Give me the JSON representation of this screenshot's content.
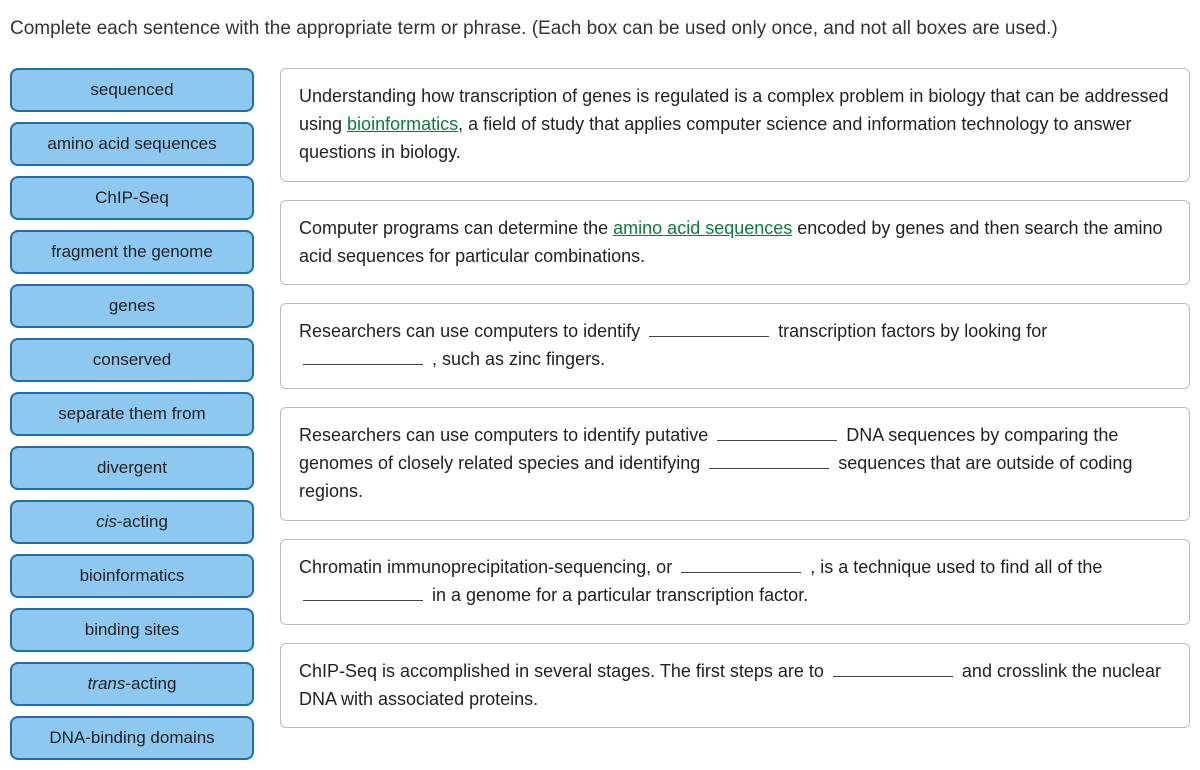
{
  "instructions": "Complete each sentence with the appropriate term or phrase. (Each box can be used only once, and not all boxes are used.)",
  "terms": [
    "sequenced",
    "amino acid sequences",
    "ChIP-Seq",
    "fragment the genome",
    "genes",
    "conserved",
    "separate them from",
    "divergent",
    "cis-acting",
    "bioinformatics",
    "binding sites",
    "trans-acting",
    "DNA-binding domains"
  ],
  "s1": {
    "p1": "Understanding how transcription of genes is regulated is a complex problem in biology that can be addressed using ",
    "ans": "bioinformatics",
    "p2": ", a field of study that applies computer science and information technology to answer questions in biology."
  },
  "s2": {
    "p1": "Computer programs can determine the ",
    "ans": "amino acid sequences",
    "p2": " encoded by genes and then search the amino acid sequences for particular combinations."
  },
  "s3": {
    "p1": "Researchers can use computers to identify ",
    "p2": " transcription factors by looking for ",
    "p3": " , such as zinc fingers."
  },
  "s4": {
    "p1": "Researchers can use computers to identify putative ",
    "p2": " DNA sequences by comparing the genomes of closely related species and identifying ",
    "p3": " sequences that are outside of coding regions."
  },
  "s5": {
    "p1": "Chromatin immunoprecipitation-sequencing, or ",
    "p2": " , is a technique used to find all of the ",
    "p3": " in a genome for a particular transcription factor."
  },
  "s6": {
    "p1": "ChIP-Seq is accomplished in several stages. The first steps are to ",
    "p2": " and crosslink the nuclear DNA with associated proteins."
  }
}
